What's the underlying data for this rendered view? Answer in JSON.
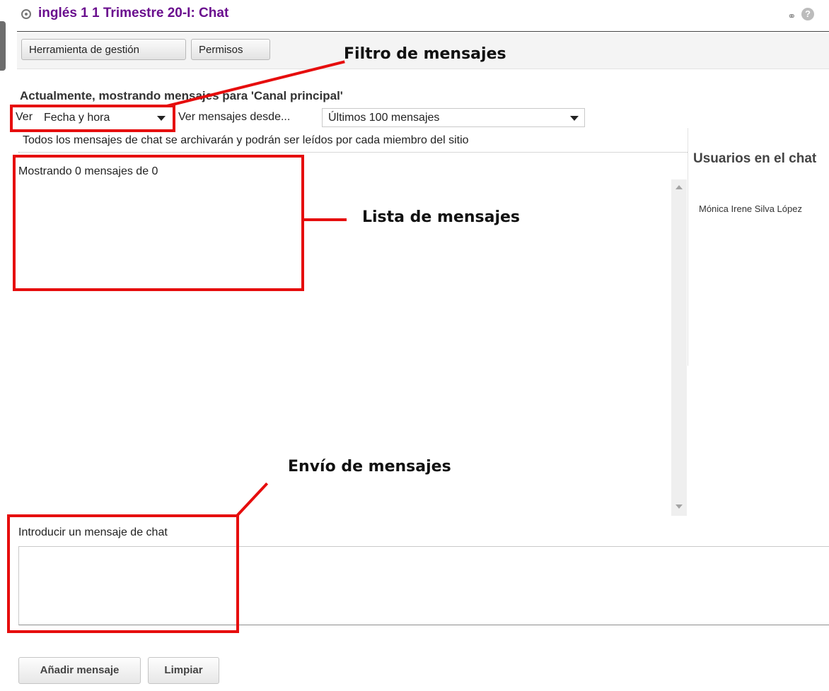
{
  "window": {
    "title": "inglés 1 1 Trimestre 20-I: Chat",
    "icons": [
      "link-icon",
      "help-icon"
    ],
    "help_glyph": "?"
  },
  "toolbar": {
    "buttons": [
      "Herramienta de gestión",
      "Permisos"
    ]
  },
  "channel": {
    "heading": "Actualmente, mostrando mensajes para 'Canal principal'"
  },
  "filters": {
    "view_label": "Ver",
    "view_value": "Fecha y hora",
    "since_label": "Ver mensajes desde...",
    "since_value": "Últimos 100 mensajes"
  },
  "archive_note": "Todos los mensajes de chat se archivarán y podrán ser leídos por cada miembro del sitio",
  "messages": {
    "status": "Mostrando 0 mensajes de 0"
  },
  "users_panel": {
    "title": "Usuarios en el chat",
    "users": [
      "Mónica Irene Silva López"
    ]
  },
  "compose": {
    "label": "Introducir un mensaje de chat",
    "value": "",
    "add_button": "Añadir mensaje",
    "clear_button": "Limpiar"
  },
  "annotations": {
    "filter": "Filtro de mensajes",
    "list": "Lista de mensajes",
    "compose": "Envío de mensajes",
    "color": "#e60d0d"
  }
}
